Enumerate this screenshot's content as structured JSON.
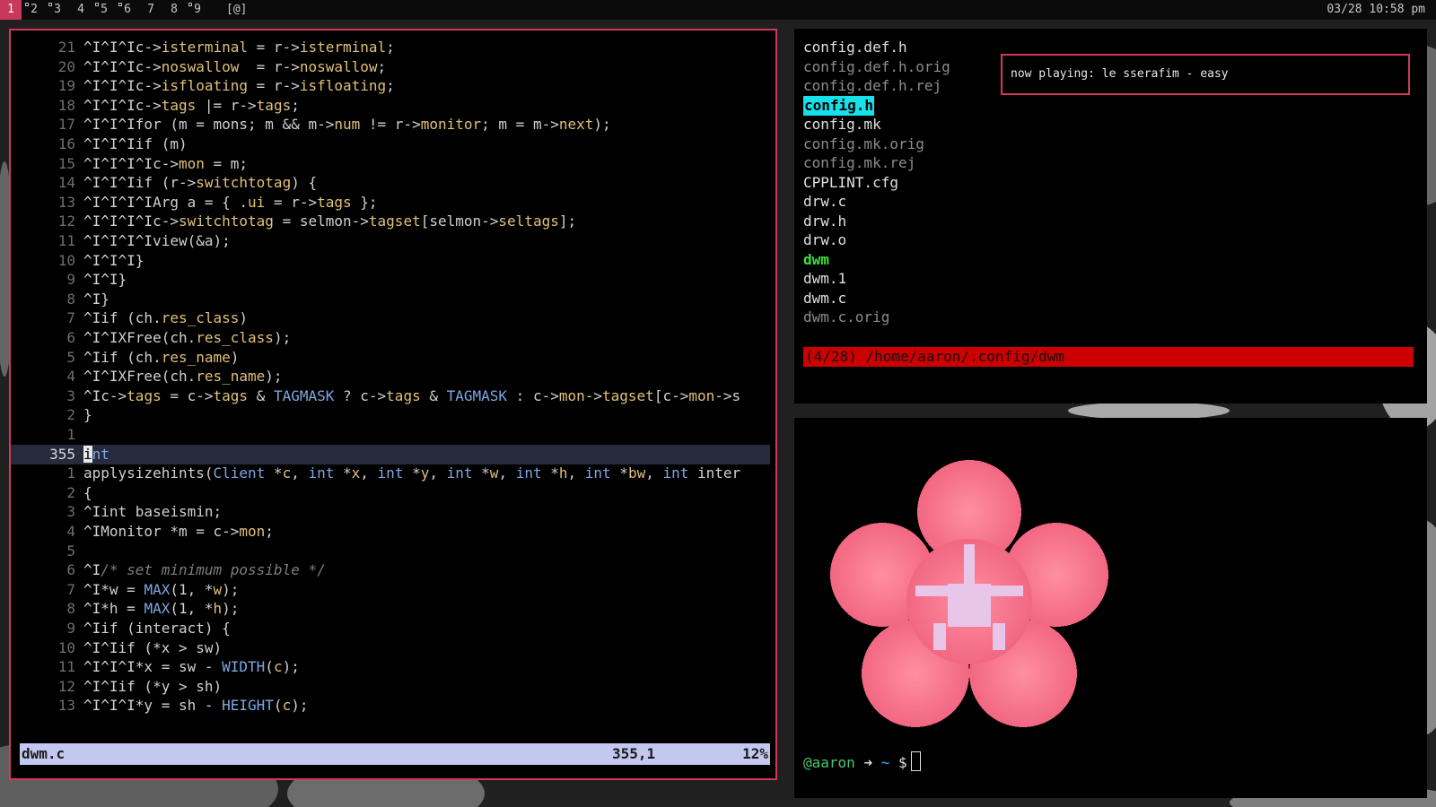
{
  "bar": {
    "tags": [
      {
        "label": "1",
        "selected": true,
        "occupied": false
      },
      {
        "label": "2",
        "selected": false,
        "occupied": true
      },
      {
        "label": "3",
        "selected": false,
        "occupied": true
      },
      {
        "label": "4",
        "selected": false,
        "occupied": false
      },
      {
        "label": "5",
        "selected": false,
        "occupied": true
      },
      {
        "label": "6",
        "selected": false,
        "occupied": true
      },
      {
        "label": "7",
        "selected": false,
        "occupied": false
      },
      {
        "label": "8",
        "selected": false,
        "occupied": false
      },
      {
        "label": "9",
        "selected": false,
        "occupied": true
      }
    ],
    "layout": "[@]",
    "clock": "03/28 10:58 pm"
  },
  "vim": {
    "lines": [
      {
        "n": "21",
        "code": "^I^I^Ic->isterminal = r->isterminal;"
      },
      {
        "n": "20",
        "code": "^I^I^Ic->noswallow  = r->noswallow;"
      },
      {
        "n": "19",
        "code": "^I^I^Ic->isfloating = r->isfloating;"
      },
      {
        "n": "18",
        "code": "^I^I^Ic->tags |= r->tags;"
      },
      {
        "n": "17",
        "code": "^I^I^Ifor (m = mons; m && m->num != r->monitor; m = m->next);"
      },
      {
        "n": "16",
        "code": "^I^I^Iif (m)"
      },
      {
        "n": "15",
        "code": "^I^I^I^Ic->mon = m;"
      },
      {
        "n": "14",
        "code": "^I^I^Iif (r->switchtotag) {"
      },
      {
        "n": "13",
        "code": "^I^I^I^IArg a = { .ui = r->tags };"
      },
      {
        "n": "12",
        "code": "^I^I^I^Ic->switchtotag = selmon->tagset[selmon->seltags];"
      },
      {
        "n": "11",
        "code": "^I^I^I^Iview(&a);"
      },
      {
        "n": "10",
        "code": "^I^I^I}"
      },
      {
        "n": "9",
        "code": "^I^I}"
      },
      {
        "n": "8",
        "code": "^I}"
      },
      {
        "n": "7",
        "code": "^Iif (ch.res_class)"
      },
      {
        "n": "6",
        "code": "^I^IXFree(ch.res_class);"
      },
      {
        "n": "5",
        "code": "^Iif (ch.res_name)"
      },
      {
        "n": "4",
        "code": "^I^IXFree(ch.res_name);"
      },
      {
        "n": "3",
        "code": "^Ic->tags = c->tags & TAGMASK ? c->tags & TAGMASK : c->mon->tagset[c->mon->s"
      },
      {
        "n": "2",
        "code": "}"
      },
      {
        "n": "1",
        "code": ""
      },
      {
        "n": "355",
        "code": "int",
        "current": true
      },
      {
        "n": "1",
        "code": "applysizehints(Client *c, int *x, int *y, int *w, int *h, int *bw, int inter"
      },
      {
        "n": "2",
        "code": "{"
      },
      {
        "n": "3",
        "code": "^Iint baseismin;"
      },
      {
        "n": "4",
        "code": "^IMonitor *m = c->mon;"
      },
      {
        "n": "5",
        "code": ""
      },
      {
        "n": "6",
        "code": "^I/* set minimum possible */"
      },
      {
        "n": "7",
        "code": "^I*w = MAX(1, *w);"
      },
      {
        "n": "8",
        "code": "^I*h = MAX(1, *h);"
      },
      {
        "n": "9",
        "code": "^Iif (interact) {"
      },
      {
        "n": "10",
        "code": "^I^Iif (*x > sw)"
      },
      {
        "n": "11",
        "code": "^I^I^I*x = sw - WIDTH(c);"
      },
      {
        "n": "12",
        "code": "^I^Iif (*y > sh)"
      },
      {
        "n": "13",
        "code": "^I^I^I*y = sh - HEIGHT(c);"
      }
    ],
    "status": {
      "file": "dwm.c",
      "position": "355,1",
      "percent": "12%"
    }
  },
  "files": {
    "entries": [
      {
        "name": "config.def.h",
        "style": "normal"
      },
      {
        "name": "config.def.h.orig",
        "style": "dim"
      },
      {
        "name": "config.def.h.rej",
        "style": "dim"
      },
      {
        "name": "config.h",
        "style": "selected"
      },
      {
        "name": "config.mk",
        "style": "normal"
      },
      {
        "name": "config.mk.orig",
        "style": "dim"
      },
      {
        "name": "config.mk.rej",
        "style": "dim"
      },
      {
        "name": "CPPLINT.cfg",
        "style": "normal"
      },
      {
        "name": "drw.c",
        "style": "normal"
      },
      {
        "name": "drw.h",
        "style": "normal"
      },
      {
        "name": "drw.o",
        "style": "normal"
      },
      {
        "name": "dwm",
        "style": "executable"
      },
      {
        "name": "dwm.1",
        "style": "normal"
      },
      {
        "name": "dwm.c",
        "style": "normal"
      },
      {
        "name": "dwm.c.orig",
        "style": "dim"
      }
    ],
    "status": "(4/28) /home/aaron/.config/dwm"
  },
  "now_playing": "now playing: le sserafim - easy",
  "terminal": {
    "user": "@aaron",
    "arrow": "➜",
    "dir": "~",
    "dollar": "$"
  },
  "colors": {
    "accent": "#d3385b",
    "petal": "#f2697f",
    "center": "#e8c6e8"
  },
  "icons": {
    "terminal_art": "cherry-blossom-icon"
  }
}
